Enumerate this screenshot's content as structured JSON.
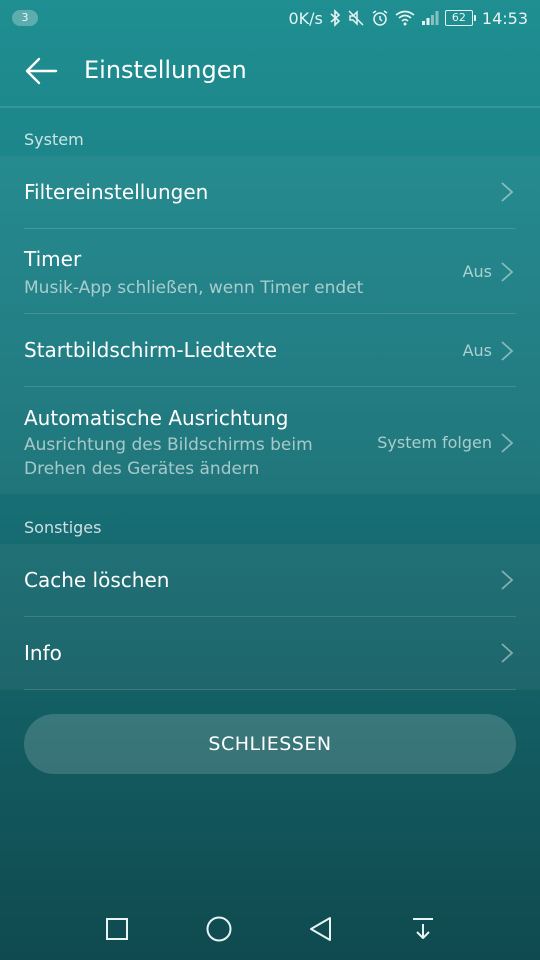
{
  "status_bar": {
    "notification_count": "3",
    "net_speed": "0K/s",
    "battery": "62",
    "time": "14:53"
  },
  "app_bar": {
    "title": "Einstellungen"
  },
  "sections": [
    {
      "header": "System",
      "items": [
        {
          "title": "Filtereinstellungen",
          "value": "",
          "subtitle": ""
        },
        {
          "title": "Timer",
          "subtitle": "Musik-App schließen, wenn Timer endet",
          "value": "Aus"
        },
        {
          "title": "Startbildschirm-Liedtexte",
          "value": "Aus",
          "subtitle": ""
        },
        {
          "title": "Automatische Ausrichtung",
          "subtitle": "Ausrichtung des Bildschirms beim Drehen des Gerätes ändern",
          "value": "System folgen"
        }
      ]
    },
    {
      "header": "Sonstiges",
      "items": [
        {
          "title": "Cache löschen",
          "value": "",
          "subtitle": ""
        },
        {
          "title": "Info",
          "value": "",
          "subtitle": ""
        }
      ]
    }
  ],
  "close_button": {
    "label": "SCHLIESSEN"
  },
  "icons": {
    "back": "arrow-left-icon",
    "chevron": "chevron-right-icon",
    "nav": [
      "square-icon",
      "circle-icon",
      "triangle-back-icon",
      "notification-pull-icon"
    ]
  },
  "colors": {
    "background_top": "#1f8f92",
    "background_bottom": "#0f4a4f"
  }
}
